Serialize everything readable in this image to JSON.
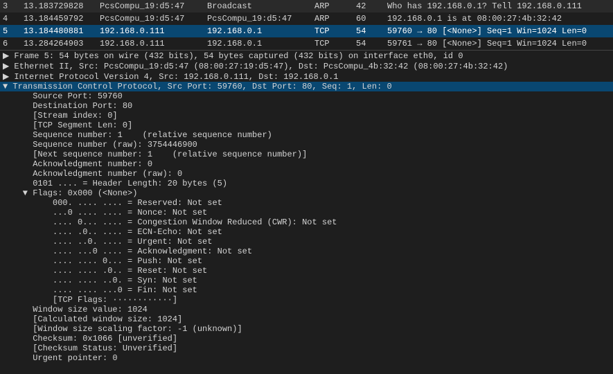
{
  "packetList": {
    "rows": [
      {
        "num": "3",
        "time": "13.183729828",
        "src": "PcsCompu_19:d5:47",
        "dst": "Broadcast",
        "proto": "ARP",
        "len": "42",
        "info": "Who has 192.168.0.1? Tell 192.168.0.111",
        "selected": false,
        "color": "default"
      },
      {
        "num": "4",
        "time": "13.184459792",
        "src": "PcsCompu_19:d5:47",
        "dst": "PcsCompu_19:d5:47",
        "proto": "ARP",
        "len": "60",
        "info": "192.168.0.1 is at 08:00:27:4b:32:42",
        "selected": false,
        "color": "default"
      },
      {
        "num": "5",
        "time": "13.184480881",
        "src": "192.168.0.111",
        "dst": "192.168.0.1",
        "proto": "TCP",
        "len": "54",
        "info": "59760 → 80  [<None>]  Seq=1 Win=1024  Len=0",
        "selected": true,
        "color": "blue"
      },
      {
        "num": "6",
        "time": "13.284264903",
        "src": "192.168.0.111",
        "dst": "192.168.0.1",
        "proto": "TCP",
        "len": "54",
        "info": "59761 → 80  [<None>]  Seq=1 Win=1024  Len=0",
        "selected": false,
        "color": "default"
      }
    ]
  },
  "detailTree": {
    "items": [
      {
        "id": "frame",
        "level": 0,
        "expanded": false,
        "arrow": "collapsed",
        "text": "Frame 5: 54 bytes on wire (432 bits), 54 bytes captured (432 bits) on interface eth0, id 0"
      },
      {
        "id": "ethernet",
        "level": 0,
        "expanded": false,
        "arrow": "collapsed",
        "text": "Ethernet II, Src: PcsCompu_19:d5:47 (08:00:27:19:d5:47), Dst: PcsCompu_4b:32:42 (08:00:27:4b:32:42)"
      },
      {
        "id": "ip",
        "level": 0,
        "expanded": false,
        "arrow": "collapsed",
        "text": "Internet Protocol Version 4, Src: 192.168.0.111, Dst: 192.168.0.1"
      },
      {
        "id": "tcp",
        "level": 0,
        "expanded": true,
        "arrow": "expanded",
        "text": "Transmission Control Protocol, Src Port: 59760, Dst Port: 80, Seq: 1, Len: 0"
      },
      {
        "id": "tcp-src-port",
        "level": 1,
        "expanded": false,
        "arrow": "leaf",
        "text": "Source Port: 59760"
      },
      {
        "id": "tcp-dst-port",
        "level": 1,
        "expanded": false,
        "arrow": "leaf",
        "text": "Destination Port: 80"
      },
      {
        "id": "tcp-stream",
        "level": 1,
        "expanded": false,
        "arrow": "leaf",
        "text": "[Stream index: 0]"
      },
      {
        "id": "tcp-seg-len",
        "level": 1,
        "expanded": false,
        "arrow": "leaf",
        "text": "[TCP Segment Len: 0]"
      },
      {
        "id": "tcp-seq",
        "level": 1,
        "expanded": false,
        "arrow": "leaf",
        "text": "Sequence number: 1    (relative sequence number)"
      },
      {
        "id": "tcp-seq-raw",
        "level": 1,
        "expanded": false,
        "arrow": "leaf",
        "text": "Sequence number (raw): 3754446900"
      },
      {
        "id": "tcp-next-seq",
        "level": 1,
        "expanded": false,
        "arrow": "leaf",
        "text": "[Next sequence number: 1    (relative sequence number)]"
      },
      {
        "id": "tcp-ack",
        "level": 1,
        "expanded": false,
        "arrow": "leaf",
        "text": "Acknowledgment number: 0"
      },
      {
        "id": "tcp-ack-raw",
        "level": 1,
        "expanded": false,
        "arrow": "leaf",
        "text": "Acknowledgment number (raw): 0"
      },
      {
        "id": "tcp-hdr-len",
        "level": 1,
        "expanded": false,
        "arrow": "leaf",
        "text": "0101 .... = Header Length: 20 bytes (5)"
      },
      {
        "id": "tcp-flags",
        "level": 1,
        "expanded": true,
        "arrow": "expanded",
        "text": "Flags: 0x000 (<None>)"
      },
      {
        "id": "tcp-flag-res",
        "level": 2,
        "expanded": false,
        "arrow": "leaf",
        "text": "000. .... .... = Reserved: Not set"
      },
      {
        "id": "tcp-flag-nonce",
        "level": 2,
        "expanded": false,
        "arrow": "leaf",
        "text": "...0 .... .... = Nonce: Not set"
      },
      {
        "id": "tcp-flag-cwr",
        "level": 2,
        "expanded": false,
        "arrow": "leaf",
        "text": ".... 0... .... = Congestion Window Reduced (CWR): Not set"
      },
      {
        "id": "tcp-flag-ecn",
        "level": 2,
        "expanded": false,
        "arrow": "leaf",
        "text": ".... .0.. .... = ECN-Echo: Not set"
      },
      {
        "id": "tcp-flag-urg",
        "level": 2,
        "expanded": false,
        "arrow": "leaf",
        "text": ".... ..0. .... = Urgent: Not set"
      },
      {
        "id": "tcp-flag-ack",
        "level": 2,
        "expanded": false,
        "arrow": "leaf",
        "text": ".... ...0 .... = Acknowledgment: Not set"
      },
      {
        "id": "tcp-flag-push",
        "level": 2,
        "expanded": false,
        "arrow": "leaf",
        "text": ".... .... 0... = Push: Not set"
      },
      {
        "id": "tcp-flag-rst",
        "level": 2,
        "expanded": false,
        "arrow": "leaf",
        "text": ".... .... .0.. = Reset: Not set"
      },
      {
        "id": "tcp-flag-syn",
        "level": 2,
        "expanded": false,
        "arrow": "leaf",
        "text": ".... .... ..0. = Syn: Not set"
      },
      {
        "id": "tcp-flag-fin",
        "level": 2,
        "expanded": false,
        "arrow": "leaf",
        "text": ".... .... ...0 = Fin: Not set"
      },
      {
        "id": "tcp-flags-raw",
        "level": 2,
        "expanded": false,
        "arrow": "leaf",
        "text": "[TCP Flags: ············]"
      },
      {
        "id": "tcp-win",
        "level": 1,
        "expanded": false,
        "arrow": "leaf",
        "text": "Window size value: 1024"
      },
      {
        "id": "tcp-calc-win",
        "level": 1,
        "expanded": false,
        "arrow": "leaf",
        "text": "[Calculated window size: 1024]"
      },
      {
        "id": "tcp-win-scale",
        "level": 1,
        "expanded": false,
        "arrow": "leaf",
        "text": "[Window size scaling factor: -1 (unknown)]"
      },
      {
        "id": "tcp-checksum",
        "level": 1,
        "expanded": false,
        "arrow": "leaf",
        "text": "Checksum: 0x1066 [unverified]"
      },
      {
        "id": "tcp-checksum-status",
        "level": 1,
        "expanded": false,
        "arrow": "leaf",
        "text": "[Checksum Status: Unverified]"
      },
      {
        "id": "tcp-urgent",
        "level": 1,
        "expanded": false,
        "arrow": "leaf",
        "text": "Urgent pointer: 0"
      }
    ]
  }
}
